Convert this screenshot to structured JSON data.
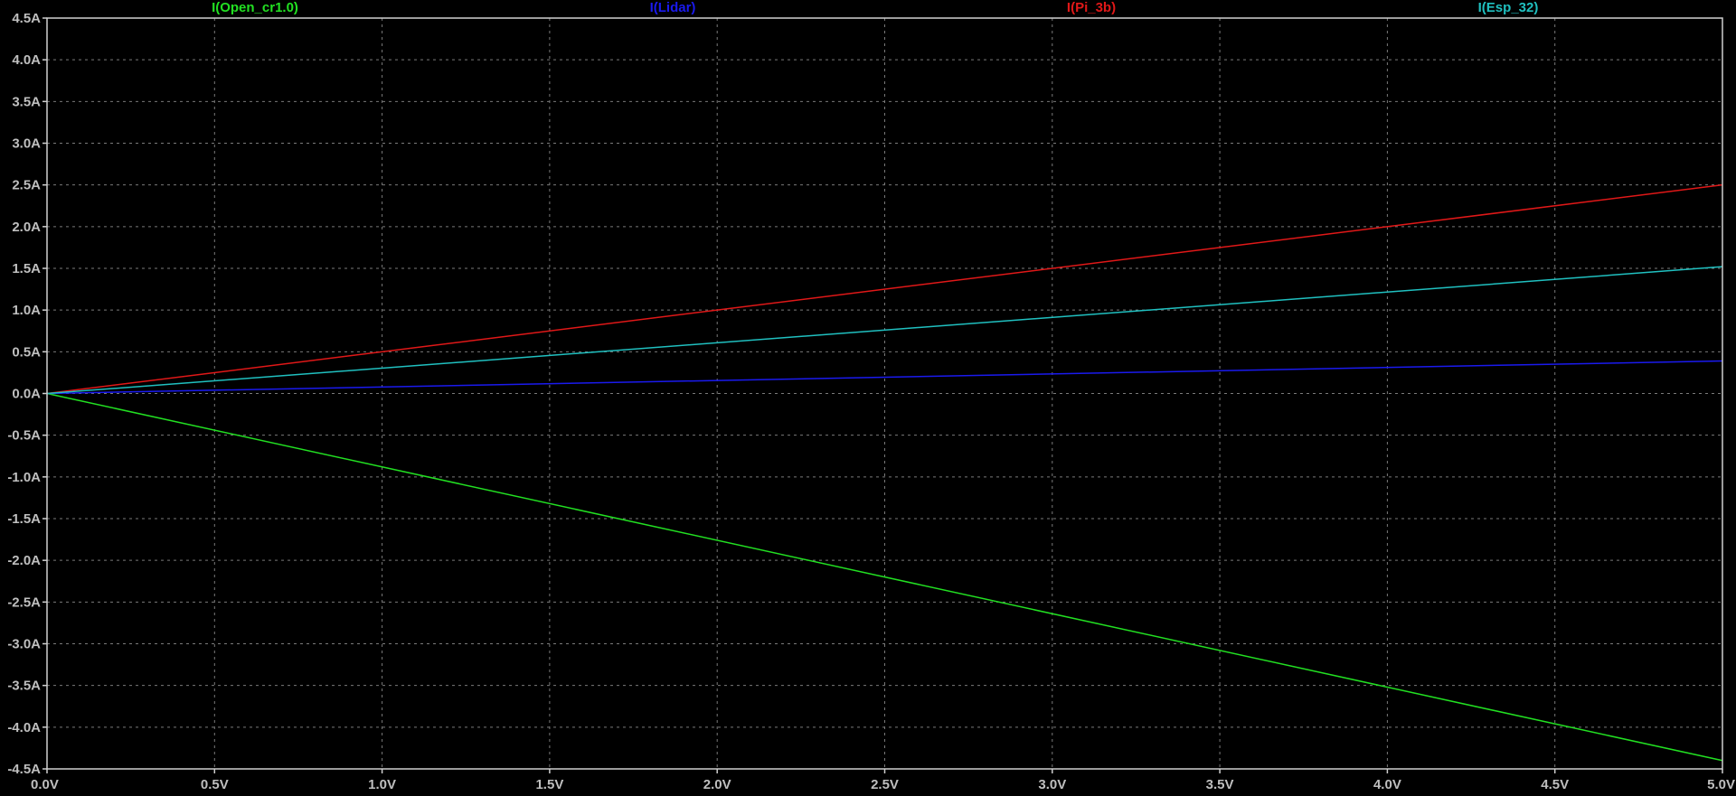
{
  "chart_data": {
    "type": "line",
    "x": [
      0.0,
      5.0
    ],
    "xlim": [
      0.0,
      5.0
    ],
    "ylim": [
      -4.5,
      4.5
    ],
    "x_ticks": [
      {
        "value": 0.0,
        "label": "0.0V"
      },
      {
        "value": 0.5,
        "label": "0.5V"
      },
      {
        "value": 1.0,
        "label": "1.0V"
      },
      {
        "value": 1.5,
        "label": "1.5V"
      },
      {
        "value": 2.0,
        "label": "2.0V"
      },
      {
        "value": 2.5,
        "label": "2.5V"
      },
      {
        "value": 3.0,
        "label": "3.0V"
      },
      {
        "value": 3.5,
        "label": "3.5V"
      },
      {
        "value": 4.0,
        "label": "4.0V"
      },
      {
        "value": 4.5,
        "label": "4.5V"
      },
      {
        "value": 5.0,
        "label": "5.0V"
      }
    ],
    "y_ticks": [
      {
        "value": 4.5,
        "label": "4.5A"
      },
      {
        "value": 4.0,
        "label": "4.0A"
      },
      {
        "value": 3.5,
        "label": "3.5A"
      },
      {
        "value": 3.0,
        "label": "3.0A"
      },
      {
        "value": 2.5,
        "label": "2.5A"
      },
      {
        "value": 2.0,
        "label": "2.0A"
      },
      {
        "value": 1.5,
        "label": "1.5A"
      },
      {
        "value": 1.0,
        "label": "1.0A"
      },
      {
        "value": 0.5,
        "label": "0.5A"
      },
      {
        "value": 0.0,
        "label": "0.0A"
      },
      {
        "value": -0.5,
        "label": "-0.5A"
      },
      {
        "value": -1.0,
        "label": "-1.0A"
      },
      {
        "value": -1.5,
        "label": "-1.5A"
      },
      {
        "value": -2.0,
        "label": "-2.0A"
      },
      {
        "value": -2.5,
        "label": "-2.5A"
      },
      {
        "value": -3.0,
        "label": "-3.0A"
      },
      {
        "value": -3.5,
        "label": "-3.5A"
      },
      {
        "value": -4.0,
        "label": "-4.0A"
      },
      {
        "value": -4.5,
        "label": "-4.5A"
      }
    ],
    "grid": true,
    "legend_position": "top",
    "background_color": "#000000",
    "grid_color": "#7a7a7a",
    "tick_label_color": "#bfbfbf",
    "series": [
      {
        "name": "I(Open_cr1.0)",
        "color": "#22e022",
        "x": [
          0.0,
          5.0
        ],
        "values": [
          0.0,
          -4.4
        ]
      },
      {
        "name": "I(Lidar)",
        "color": "#1a1aee",
        "x": [
          0.0,
          5.0
        ],
        "values": [
          0.0,
          0.39
        ]
      },
      {
        "name": "I(Pi_3b)",
        "color": "#e01818",
        "x": [
          0.0,
          5.0
        ],
        "values": [
          0.0,
          2.5
        ]
      },
      {
        "name": "I(Esp_32)",
        "color": "#20c0c0",
        "x": [
          0.0,
          5.0
        ],
        "values": [
          0.0,
          1.52
        ]
      }
    ]
  }
}
